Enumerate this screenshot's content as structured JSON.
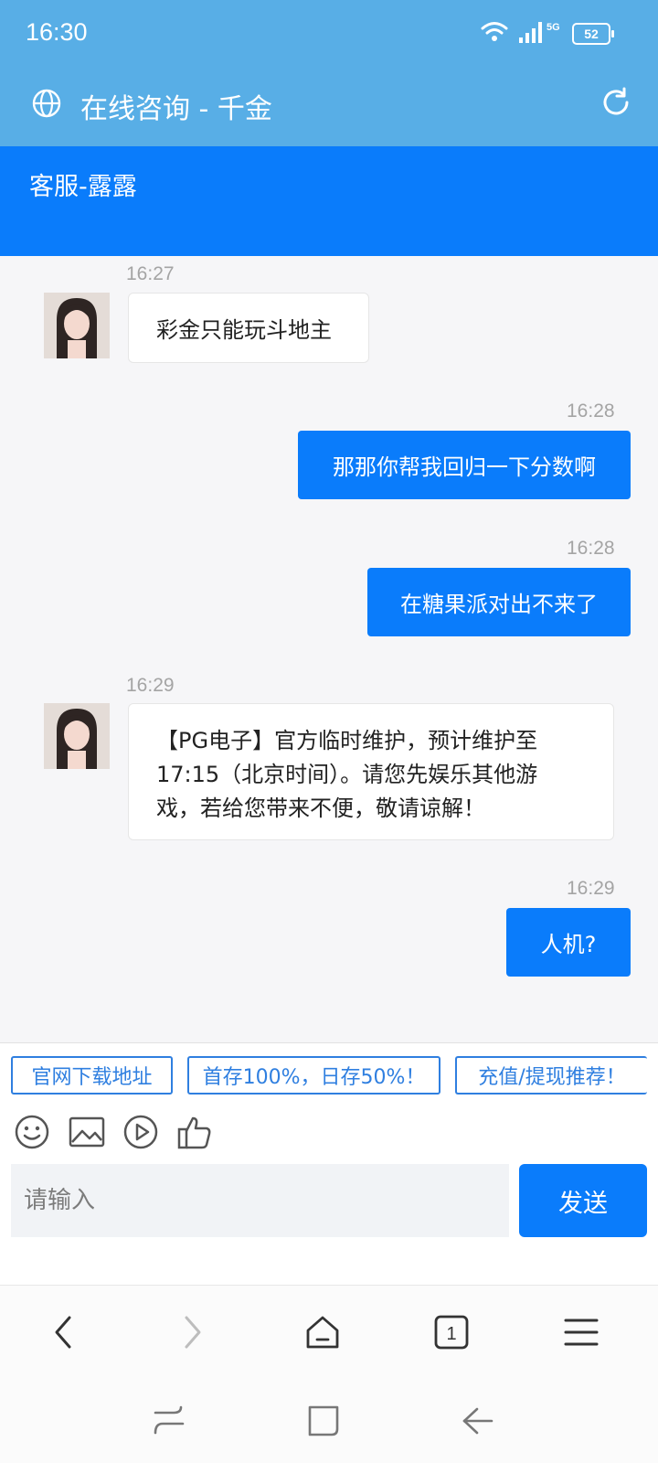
{
  "status_bar": {
    "time": "16:30",
    "network": "5G",
    "battery": "52",
    "icons": [
      "wifi-icon",
      "signal-icon",
      "battery-icon"
    ]
  },
  "title_bar": {
    "title": "在线咨询 - 千金",
    "left_icon": "globe-icon",
    "right_icon": "refresh-icon"
  },
  "agent": {
    "name": "客服-露露"
  },
  "messages": [
    {
      "side": "in",
      "time": "16:27",
      "text": "彩金只能玩斗地主"
    },
    {
      "side": "out",
      "time": "16:28",
      "text": "那那你帮我回归一下分数啊"
    },
    {
      "side": "out",
      "time": "16:28",
      "text": "在糖果派对出不来了"
    },
    {
      "side": "in",
      "time": "16:29",
      "text_lines": [
        "【PG电子】官方临时维护，预计维护至",
        "17:15（北京时间）。请您先娱乐其他游",
        "戏，若给您带来不便，敬请谅解！"
      ]
    },
    {
      "side": "out",
      "time": "16:29",
      "text": "人机?"
    }
  ],
  "quick_replies": [
    "官网下载地址",
    "首存100%，日存50%！",
    "充值/提现推荐！"
  ],
  "toolbar_icons": [
    "emoji-icon",
    "image-icon",
    "video-icon",
    "thumbs-up-icon"
  ],
  "composer": {
    "placeholder": "请输入",
    "send_label": "发送"
  },
  "browser_nav": {
    "tab_count": "1",
    "icons": [
      "back-icon",
      "forward-icon",
      "home-icon",
      "tabs-icon",
      "menu-icon"
    ]
  },
  "system_nav": {
    "icons": [
      "recents-icon",
      "home-square-icon",
      "back-arrow-icon"
    ]
  },
  "colors": {
    "title_bar": "#58aee6",
    "agent_bar": "#0a7cfb",
    "outgoing_bubble": "#0a7cfb",
    "quick_reply_border": "#2f7fe0"
  }
}
